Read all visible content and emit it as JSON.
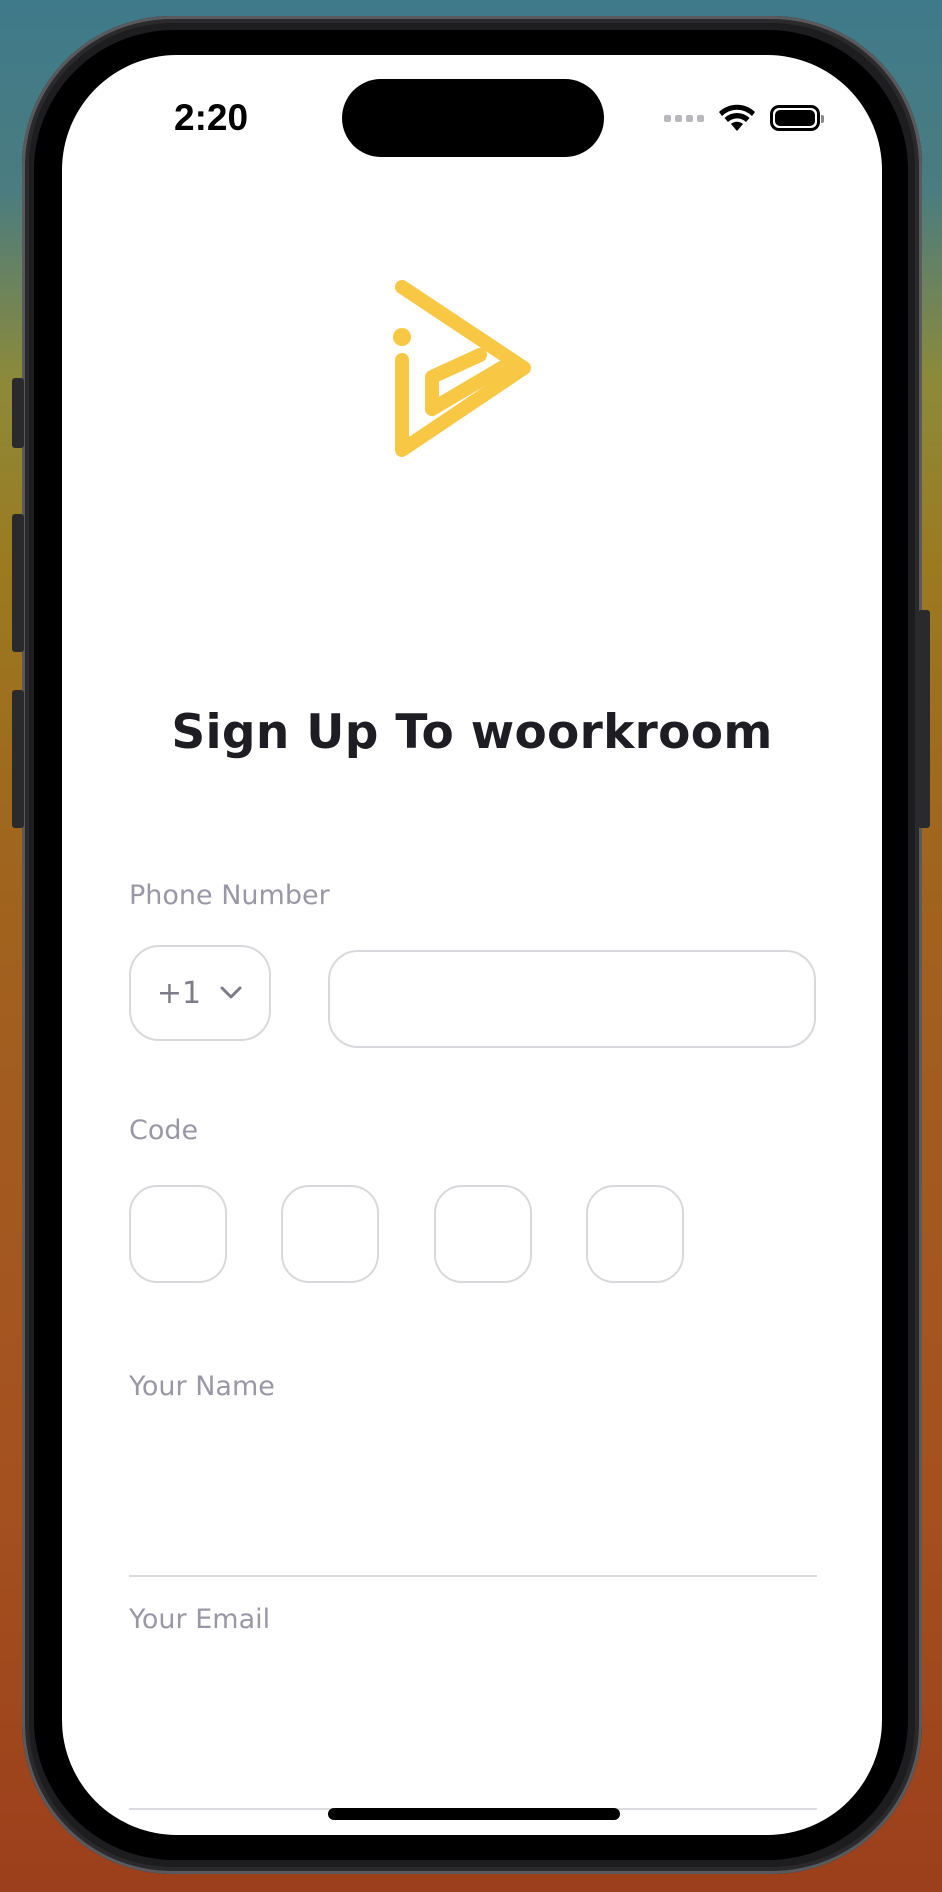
{
  "status_bar": {
    "time": "2:20",
    "icons": [
      "signal-dots-icon",
      "wifi-icon",
      "battery-icon"
    ]
  },
  "brand": {
    "logo_icon": "play-logo-icon",
    "accent_color": "#F8C844"
  },
  "title": "Sign Up To woorkroom",
  "form": {
    "phone": {
      "label": "Phone Number",
      "country_code": "+1",
      "value": "",
      "placeholder": ""
    },
    "code": {
      "label": "Code",
      "digits": [
        "",
        "",
        "",
        ""
      ]
    },
    "name": {
      "label": "Your Name",
      "value": ""
    },
    "email": {
      "label": "Your Email",
      "value": ""
    }
  },
  "colors": {
    "title_text": "#1F1D24",
    "label_text": "#9A98A6",
    "border": "#D9D9DD"
  }
}
